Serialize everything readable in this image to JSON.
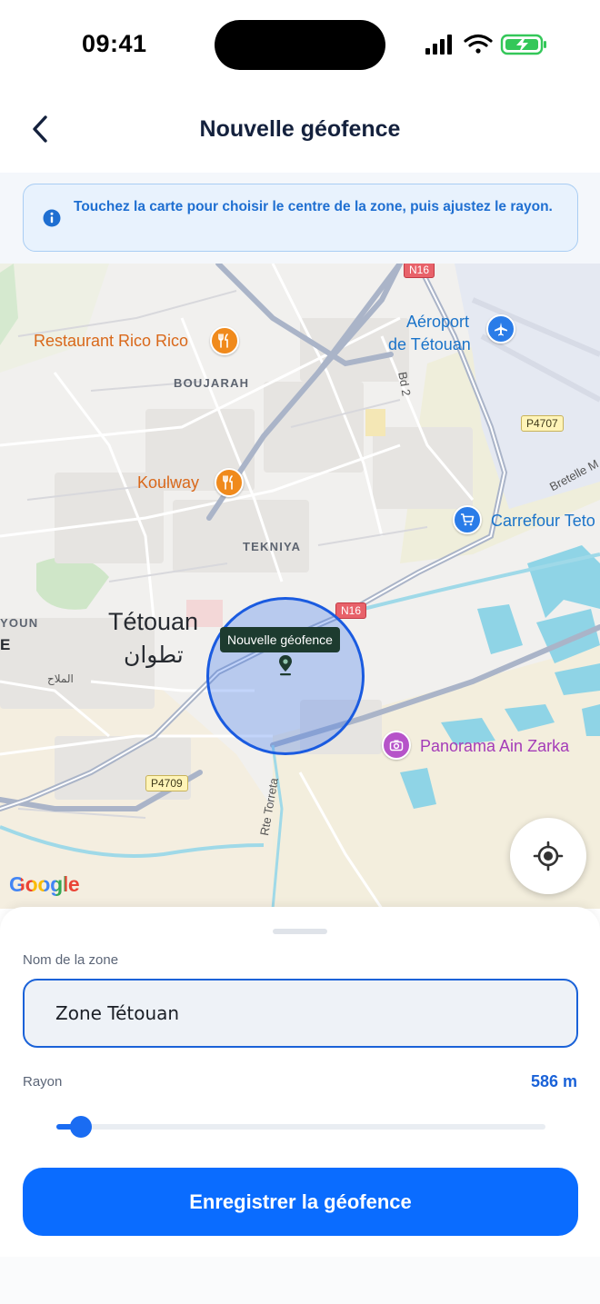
{
  "status_bar": {
    "time": "09:41"
  },
  "header": {
    "title": "Nouvelle géofence",
    "back_icon": "chevron-left-icon"
  },
  "info_banner": {
    "icon": "info-icon",
    "text": "Touchez la carte pour choisir le centre de la zone, puis ajustez le rayon."
  },
  "map": {
    "labels": {
      "restaurant_rico_rico": "Restaurant Rico Rico",
      "koulway": "Koulway",
      "aeroport": "Aéroport",
      "de_tetouan": "de Tétouan",
      "carrefour": "Carrefour Teto",
      "panorama": "Panorama Ain Zarka",
      "boujarah": "BOUJARAH",
      "tekniya": "TEKNIYA",
      "tetouan": "Tétouan",
      "tetouan_ar": "تطوان",
      "mellah_ar": "الملاح",
      "youn": "YOUN",
      "e_edge": "E",
      "bd2": "Bd 2",
      "bretelle": "Bretelle M",
      "rte_torreta": "Rte Torreta"
    },
    "road_shields": {
      "n16_top": "N16",
      "n16_center": "N16",
      "p4707": "P4707",
      "p4709": "P4709"
    },
    "geofence_label": "Nouvelle géofence",
    "attribution": "Google",
    "locate_icon": "crosshair-icon"
  },
  "form": {
    "zone_name_label": "Nom de la zone",
    "zone_name_value": "Zone Tétouan",
    "radius_label": "Rayon",
    "radius_value": "586 m",
    "radius_slider_fraction": 0.05,
    "save_label": "Enregistrer la géofence"
  },
  "colors": {
    "accent": "#0a6cff",
    "title": "#14213d",
    "banner_text": "#1f6fd1",
    "geofence_fill": "#4278f0"
  }
}
